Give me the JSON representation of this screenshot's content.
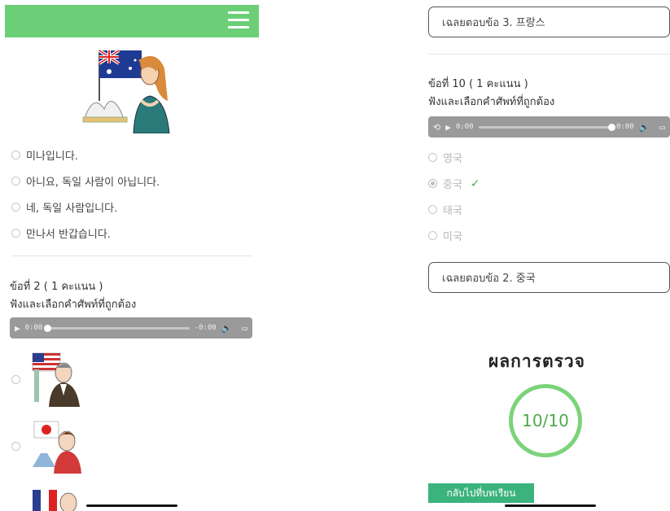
{
  "left": {
    "options_q1": [
      "미나입니다.",
      "아니요, 독일 사람이 아닙니다.",
      "네, 독일 사람입니다.",
      "만나서 반갑습니다."
    ],
    "question2": {
      "title": "ข้อที่ 2 ( 1 คะแนน )",
      "instruction": "ฟังและเลือกคำศัพท์ที่ถูกต้อง",
      "player": {
        "current": "0:00",
        "duration": "-0:00",
        "progress": 0.0
      }
    }
  },
  "right": {
    "answer_prev": "เฉลยตอบข้อ 3. 프랑스",
    "question10": {
      "title": "ข้อที่ 10 ( 1 คะแนน )",
      "instruction": "ฟังและเลือกคำศัพท์ที่ถูกต้อง",
      "player": {
        "current": "0:00",
        "duration": "0:00",
        "progress": 1.0
      },
      "options": [
        "영국",
        "중국",
        "태국",
        "미국"
      ],
      "selected_index": 1,
      "check_mark": "✓"
    },
    "answer_current": "เฉลยตอบข้อ 2. 중국",
    "result": {
      "title": "ผลการตรวจ",
      "score": "10/10"
    },
    "back_button": "กลับไปที่บทเรียน"
  },
  "icons": {
    "menu": "hamburger-icon",
    "play": "play-icon",
    "volume": "volume-icon",
    "airplay": "airplay-icon",
    "check": "checkmark-icon"
  },
  "colors": {
    "topbar": "#6ccf78",
    "score_ring": "#7cd37a",
    "button": "#3bb37d",
    "check": "#4caf50"
  }
}
